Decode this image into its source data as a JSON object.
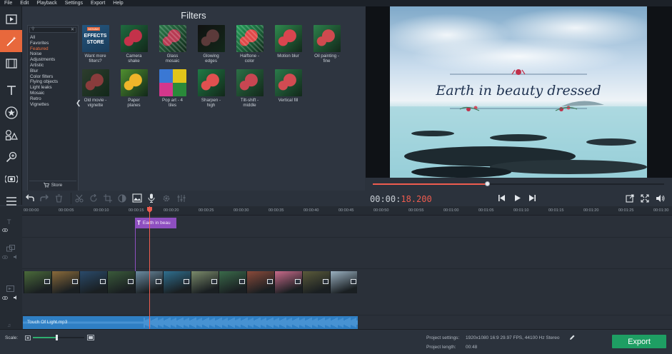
{
  "menu": [
    "File",
    "Edit",
    "Playback",
    "Settings",
    "Export",
    "Help"
  ],
  "tools": [
    "video-icon",
    "magic-wand-icon",
    "filmstrip-icon",
    "text-icon",
    "star-icon",
    "shapes-icon",
    "zoom-icon",
    "camera-icon",
    "list-icon"
  ],
  "filters": {
    "title": "Filters",
    "categories": [
      "All",
      "Favorites",
      "Featured",
      "Noise",
      "Adjustments",
      "Artistic",
      "Blur",
      "Color filters",
      "Flying objects",
      "Light leaks",
      "Mosaic",
      "Retro",
      "Vignettes"
    ],
    "selected_category": "Featured",
    "store_label": "Store",
    "items": [
      {
        "line1": "Want more",
        "line2": "filters?",
        "line3": ""
      },
      {
        "line1": "Camera",
        "line2": "shake",
        "line3": ""
      },
      {
        "line1": "Glass",
        "line2": "mosaic",
        "line3": ""
      },
      {
        "line1": "Glowing",
        "line2": "edges",
        "line3": ""
      },
      {
        "line1": "Halftone -",
        "line2": "color",
        "line3": ""
      },
      {
        "line1": "Motion blur",
        "line2": "",
        "line3": ""
      },
      {
        "line1": "Oil painting -",
        "line2": "fine",
        "line3": ""
      },
      {
        "line1": "Old movie -",
        "line2": "vignette",
        "line3": ""
      },
      {
        "line1": "Paper",
        "line2": "planes",
        "line3": ""
      },
      {
        "line1": "Pop art - 4",
        "line2": "tiles",
        "line3": ""
      },
      {
        "line1": "Sharpen -",
        "line2": "high",
        "line3": ""
      },
      {
        "line1": "Tilt-shift -",
        "line2": "middle",
        "line3": ""
      },
      {
        "line1": "Vertical fill",
        "line2": "",
        "line3": ""
      }
    ],
    "store_tile": {
      "badge": "MOVAVI",
      "line1": "EFFECTS",
      "line2": "STORE"
    }
  },
  "preview": {
    "title_text": "Earth in beauty dressed",
    "progress": 0.395
  },
  "playback": {
    "time_main": "00:00:",
    "time_accent": "18.200"
  },
  "ruler": [
    "00:00:00",
    "00:00:05",
    "00:00:10",
    "00:00:15",
    "00:00:20",
    "00:00:25",
    "00:00:30",
    "00:00:35",
    "00:00:40",
    "00:00:45",
    "00:00:50",
    "00:00:55",
    "00:01:00",
    "00:01:05",
    "00:01:10",
    "00:01:15",
    "00:01:20",
    "00:01:25",
    "00:01:30"
  ],
  "timeline": {
    "title_clip": "Earth in beau",
    "audio_clip": "Touch Of Light.mp3"
  },
  "bottom": {
    "scale_label": "Scale:",
    "settings_label": "Project settings:",
    "settings_value": "1920x1080 16:9 29.97 FPS, 44100 Hz Stereo",
    "length_label": "Project length:",
    "length_value": "00:48",
    "export_label": "Export",
    "scale_level": 0.72
  },
  "colors": {
    "accent": "#e8683c",
    "title_clip": "#8e4fc0",
    "audio_clip": "#2f7fc4",
    "export": "#1e9e63",
    "playhead": "#ee5c4f"
  }
}
